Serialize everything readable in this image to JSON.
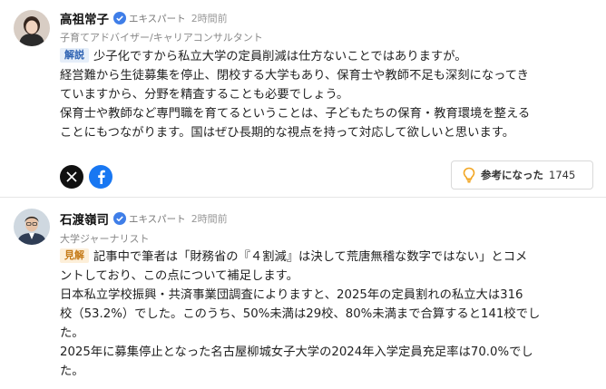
{
  "comments": [
    {
      "name": "高祖常子",
      "badge": "エキスパート",
      "time": "2時間前",
      "role": "子育てアドバイザー/キャリアコンサルタント",
      "tag": "解説",
      "lines": [
        "少子化ですから私立大学の定員削減は仕方ないことではありますが。",
        "経営難から生徒募集を停止、閉校する大学もあり、保育士や教師不足も深刻になってき",
        "ていますから、分野を精査することも必要でしょう。",
        "保育士や教師など専門職を育てるということは、子どもたちの保育・教育環境を整える",
        "ことにもつながります。国はぜひ長期的な視点を持って対応して欲しいと思います。"
      ],
      "share_icons": [
        "x-icon",
        "facebook-icon"
      ],
      "helpful_label": "参考になった",
      "helpful_count": "1745"
    },
    {
      "name": "石渡嶺司",
      "badge": "エキスパート",
      "time": "2時間前",
      "role": "大学ジャーナリスト",
      "tag": "見解",
      "lines": [
        "記事中で筆者は「財務省の『４割減』は決して荒唐無稽な数字ではない」とコメ",
        "ントしており、この点について補足します。",
        "日本私立学校振興・共済事業団調査によりますと、2025年の定員割れの私立大は316",
        "校（53.2%）でした。このうち、50%未満は29校、80%未満まで合算すると141校でし",
        "た。",
        "2025年に募集停止となった名古屋柳城女子大学の2024年入学定員充足率は70.0%でし",
        "た。"
      ]
    }
  ],
  "colors": {
    "expert_check": "#3f7ee8",
    "tag_kaisetsu_bg": "#e5eef9",
    "tag_kenkai_bg": "#fdefd9",
    "facebook": "#1877f2",
    "bulb": "#f2a623"
  }
}
